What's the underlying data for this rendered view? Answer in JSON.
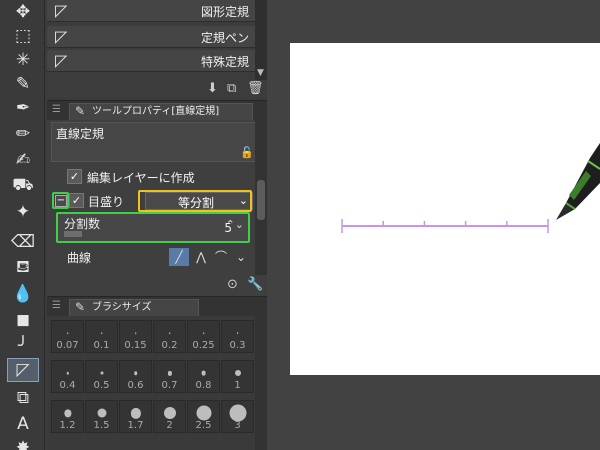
{
  "colors": {
    "highlight_green": "#3fd04a",
    "highlight_yellow": "#f2c21b",
    "ruler_line": "#c694f0",
    "canvas": "#ffffff",
    "workspace": "#424242"
  },
  "toolstrip": {
    "icons": [
      "move-icon",
      "selection-icon",
      "auto-select-icon",
      "eyedropper-icon",
      "pen-icon",
      "pencil-icon",
      "brush-icon",
      "airbrush-icon",
      "fill-icon",
      "sparkle-icon",
      "eraser-icon",
      "fill-bucket-icon",
      "blend-icon",
      "gradient-icon",
      "curve-icon",
      "ruler-icon",
      "layer-icon",
      "text-icon",
      "more-icon"
    ]
  },
  "subtools": {
    "items": [
      {
        "label": "図形定規"
      },
      {
        "label": "定規ペン"
      },
      {
        "label": "特殊定規"
      }
    ]
  },
  "tool_property": {
    "tab_label": "ツールプロパティ[直線定規]",
    "tool_name": "直線定規",
    "create_on_edit_layer_label": "編集レイヤーに作成",
    "create_on_edit_layer_checked": true,
    "scale_label": "目盛り",
    "scale_checked": true,
    "expander_symbol": "−",
    "scale_mode_value": "等分割",
    "divisions_label": "分割数",
    "divisions_value": "5",
    "curve_label": "曲線"
  },
  "brush_size": {
    "tab_label": "ブラシサイズ",
    "sizes": [
      "0.07",
      "0.1",
      "0.15",
      "0.2",
      "0.25",
      "0.3",
      "0.4",
      "0.5",
      "0.6",
      "0.7",
      "0.8",
      "1",
      "1.2",
      "1.5",
      "1.7",
      "2",
      "2.5",
      "3"
    ]
  },
  "canvas": {
    "ruler_ticks": 5
  }
}
